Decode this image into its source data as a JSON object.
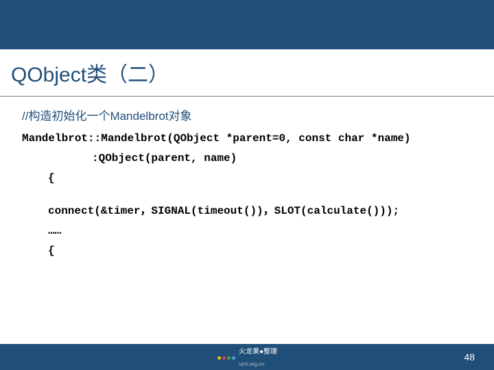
{
  "slide": {
    "title": "QObject类（二）",
    "comment": "//构造初始化一个Mandelbrot对象",
    "code": {
      "line1": "Mandelbrot::Mandelbrot(QObject *parent=0, const char *name)",
      "line2": ":QObject(parent, name)",
      "brace_open": "{",
      "connect": "connect(&timer，SIGNAL(timeout())，SLOT(calculate()));",
      "ellipsis": "……",
      "brace_open2": "{"
    }
  },
  "footer": {
    "logo_title": "火龙果●整理",
    "logo_url": "uml.org.cn",
    "page_number": "48"
  }
}
